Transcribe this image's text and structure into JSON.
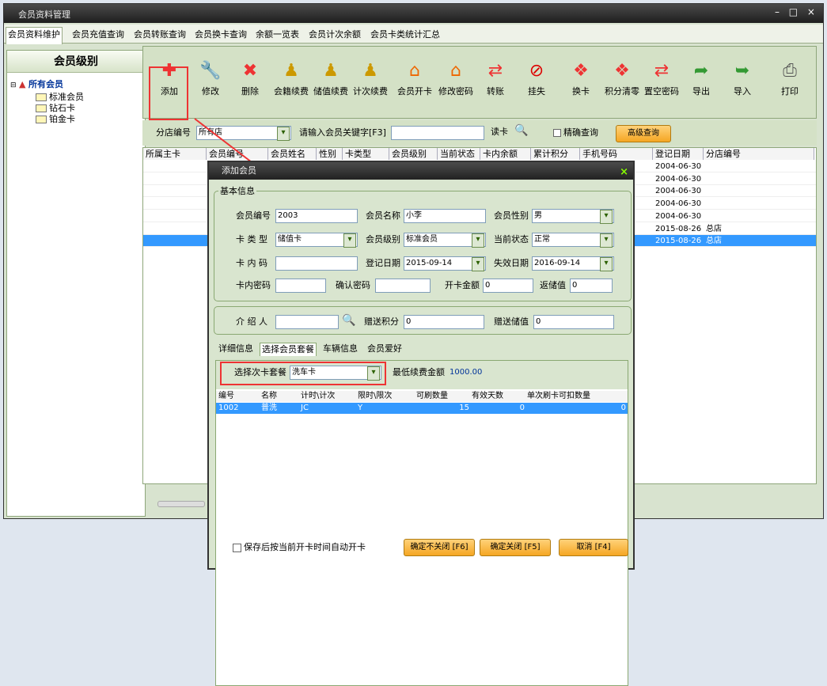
{
  "window": {
    "title": "会员资料管理",
    "controls": "– □ ×"
  },
  "tabs": [
    "会员资料维护",
    "会员充值查询",
    "会员转账查询",
    "会员换卡查询",
    "余额一览表",
    "会员计次余额",
    "会员卡类统计汇总"
  ],
  "left": {
    "header": "会员级别",
    "root": "所有会员",
    "children": [
      "标准会员",
      "钻石卡",
      "铂金卡"
    ]
  },
  "toolbar": [
    {
      "label": "添加",
      "icon": "plus-icon",
      "color": "#e33"
    },
    {
      "label": "修改",
      "icon": "wrench-icon",
      "color": "#666"
    },
    {
      "label": "删除",
      "icon": "delete-x-icon",
      "color": "#e33"
    },
    {
      "label": "会籍续费",
      "icon": "figure-icon",
      "color": "#c90"
    },
    {
      "label": "储值续费",
      "icon": "figure-icon",
      "color": "#c90"
    },
    {
      "label": "计次续费",
      "icon": "figure-icon",
      "color": "#c90"
    },
    {
      "label": "会员开卡",
      "icon": "house-icon",
      "color": "#e60"
    },
    {
      "label": "修改密码",
      "icon": "house-icon",
      "color": "#e60"
    },
    {
      "label": "转账",
      "icon": "transfer-icon",
      "color": "#e33"
    },
    {
      "label": "挂失",
      "icon": "no-icon",
      "color": "#d00"
    },
    {
      "label": "换卡",
      "icon": "swap-icon",
      "color": "#e33"
    },
    {
      "label": "积分清零",
      "icon": "swap-icon",
      "color": "#e33"
    },
    {
      "label": "置空密码",
      "icon": "transfer-icon",
      "color": "#e33"
    },
    {
      "label": "导出",
      "icon": "export-icon",
      "color": "#393"
    },
    {
      "label": "导入",
      "icon": "import-icon",
      "color": "#393"
    },
    {
      "label": "打印",
      "icon": "printer-icon",
      "color": "#555"
    }
  ],
  "filter": {
    "branch_label": "分店编号",
    "branch_value": "所有店",
    "keyword_label": "请输入会员关键字[F3]",
    "keyword_value": "",
    "read_card": "读卡",
    "exact_label": "精确查询",
    "advanced": "高级查询"
  },
  "grid": {
    "headers": [
      "所属主卡",
      "会员编号",
      "会员姓名",
      "性别",
      "卡类型",
      "会员级别",
      "当前状态",
      "卡内余额",
      "累计积分",
      "手机号码",
      "登记日期",
      "分店编号"
    ],
    "rows": [
      {
        "date": "2004-06-30",
        "branch": ""
      },
      {
        "date": "2004-06-30",
        "branch": ""
      },
      {
        "date": "2004-06-30",
        "branch": ""
      },
      {
        "date": "2004-06-30",
        "branch": ""
      },
      {
        "date": "2004-06-30",
        "branch": ""
      },
      {
        "date": "2015-08-26",
        "branch": "总店"
      },
      {
        "date": "2015-08-26",
        "branch": "总店"
      }
    ],
    "selected_index": 6
  },
  "dialog": {
    "title": "添加会员",
    "basic_group": "基本信息",
    "member_no_label": "会员编号",
    "member_no": "2003",
    "member_name_label": "会员名称",
    "member_name": "小李",
    "gender_label": "会员性别",
    "gender": "男",
    "card_type_label": "卡 类 型",
    "card_type": "储值卡",
    "level_label": "会员级别",
    "level": "标准会员",
    "status_label": "当前状态",
    "status": "正常",
    "card_code_label": "卡 内 码",
    "card_code": "",
    "reg_date_label": "登记日期",
    "reg_date": "2015-09-14",
    "expire_label": "失效日期",
    "expire_date": "2016-09-14",
    "pwd_label": "卡内密码",
    "pwd": "",
    "confirm_pwd_label": "确认密码",
    "confirm_pwd": "",
    "open_amount_label": "开卡金额",
    "open_amount": "0",
    "return_label": "返储值",
    "return_value": "0",
    "referrer_label": "介 绍 人",
    "referrer": "",
    "gift_points_label": "赠送积分",
    "gift_points": "0",
    "gift_value_label": "赠送储值",
    "gift_value": "0",
    "subtabs": [
      "详细信息",
      "选择会员套餐",
      "车辆信息",
      "会员爱好"
    ],
    "pkg_label": "选择次卡套餐",
    "pkg_value": "洗车卡",
    "min_fee_label": "最低续费金额",
    "min_fee": "1000.00",
    "pkg_headers": [
      "编号",
      "名称",
      "计时\\计次",
      "限时\\限次",
      "可刷数量",
      "有效天数",
      "单次刷卡可扣数量"
    ],
    "pkg_row": {
      "no": "1002",
      "name": "普洗",
      "code": "JC",
      "limit": "Y",
      "qty": "15",
      "days": "0",
      "deduct": "0"
    },
    "auto_open_label": "保存后按当前开卡时间自动开卡",
    "btn_save_keep": "确定不关闭 [F6]",
    "btn_save_close": "确定关闭 [F5]",
    "btn_cancel": "取消 [F4]"
  }
}
